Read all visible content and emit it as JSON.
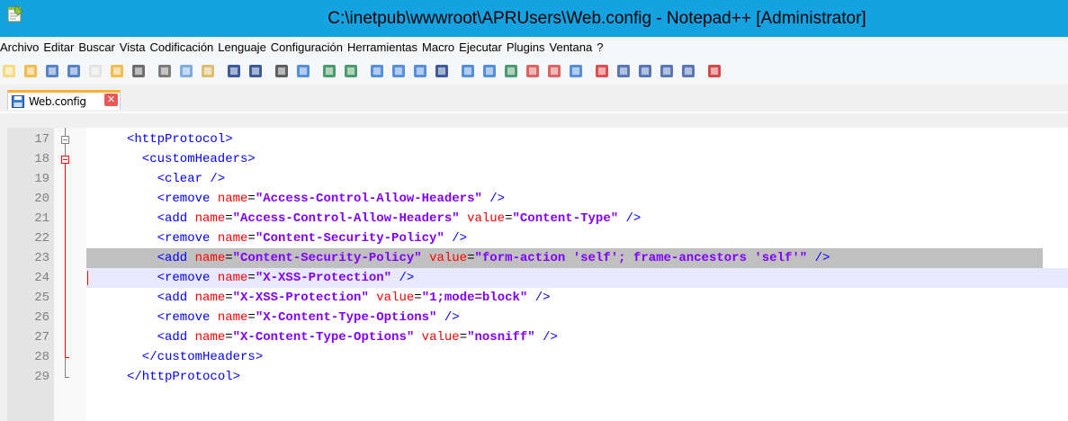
{
  "window": {
    "title": "C:\\inetpub\\wwwroot\\APRUsers\\Web.config - Notepad++ [Administrator]",
    "accent": "#15a2e1"
  },
  "menu": {
    "items": [
      "Archivo",
      "Editar",
      "Buscar",
      "Vista",
      "Codificación",
      "Lenguaje",
      "Configuración",
      "Herramientas",
      "Macro",
      "Ejecutar",
      "Plugins",
      "Ventana",
      "?"
    ]
  },
  "toolbar": {
    "icons": [
      "new-file-icon",
      "open-file-icon",
      "save-icon",
      "save-all-icon",
      "close-icon",
      "close-all-icon",
      "print-icon",
      "cut-icon",
      "copy-icon",
      "paste-icon",
      "undo-icon",
      "redo-icon",
      "find-icon",
      "replace-icon",
      "zoom-in-icon",
      "zoom-out-icon",
      "sync-vertical-icon",
      "sync-horizontal-icon",
      "word-wrap-icon",
      "show-all-chars-icon",
      "indent-guide-icon",
      "user-lang-icon",
      "doc-map-icon",
      "function-list-icon",
      "folder-workspace-icon",
      "monitor-icon",
      "record-macro-icon",
      "stop-macro-icon",
      "play-macro-icon",
      "run-macro-multiple-icon",
      "save-macro-icon",
      "spell-check-icon"
    ]
  },
  "tab": {
    "label": "Web.config",
    "close_symbol": "✕"
  },
  "editor": {
    "lines": [
      {
        "num": "17",
        "indent": "",
        "parts": [
          [
            "tag",
            "<httpProtocol>"
          ]
        ]
      },
      {
        "num": "18",
        "indent": "  ",
        "parts": [
          [
            "tag",
            "<customHeaders>"
          ]
        ]
      },
      {
        "num": "19",
        "indent": "    ",
        "parts": [
          [
            "tag",
            "<clear />"
          ]
        ]
      },
      {
        "num": "20",
        "indent": "    ",
        "parts": [
          [
            "tag",
            "<remove "
          ],
          [
            "attr",
            "name"
          ],
          [
            "eq",
            "="
          ],
          [
            "val",
            "\"Access-Control-Allow-Headers\""
          ],
          [
            "tag",
            " />"
          ]
        ]
      },
      {
        "num": "21",
        "indent": "    ",
        "parts": [
          [
            "tag",
            "<add "
          ],
          [
            "attr",
            "name"
          ],
          [
            "eq",
            "="
          ],
          [
            "val",
            "\"Access-Control-Allow-Headers\""
          ],
          [
            "tag",
            " "
          ],
          [
            "attr",
            "value"
          ],
          [
            "eq",
            "="
          ],
          [
            "val",
            "\"Content-Type\""
          ],
          [
            "tag",
            " />"
          ]
        ]
      },
      {
        "num": "22",
        "indent": "    ",
        "parts": [
          [
            "tag",
            "<remove "
          ],
          [
            "attr",
            "name"
          ],
          [
            "eq",
            "="
          ],
          [
            "val",
            "\"Content-Security-Policy\""
          ],
          [
            "tag",
            " />"
          ]
        ]
      },
      {
        "num": "23",
        "indent": "    ",
        "parts": [
          [
            "tag",
            "<add "
          ],
          [
            "attr",
            "name"
          ],
          [
            "eq",
            "="
          ],
          [
            "val",
            "\"Content-Security-Policy\""
          ],
          [
            "tag",
            " "
          ],
          [
            "attr",
            "value"
          ],
          [
            "eq",
            "="
          ],
          [
            "val",
            "\"form-action 'self'; frame-ancestors 'self'\""
          ],
          [
            "tag",
            " />"
          ]
        ]
      },
      {
        "num": "24",
        "indent": "    ",
        "parts": [
          [
            "tag",
            "<remove "
          ],
          [
            "attr",
            "name"
          ],
          [
            "eq",
            "="
          ],
          [
            "val",
            "\"X-XSS-Protection\""
          ],
          [
            "tag",
            " />"
          ]
        ]
      },
      {
        "num": "25",
        "indent": "    ",
        "parts": [
          [
            "tag",
            "<add "
          ],
          [
            "attr",
            "name"
          ],
          [
            "eq",
            "="
          ],
          [
            "val",
            "\"X-XSS-Protection\""
          ],
          [
            "tag",
            " "
          ],
          [
            "attr",
            "value"
          ],
          [
            "eq",
            "="
          ],
          [
            "val",
            "\"1;mode=block\""
          ],
          [
            "tag",
            " />"
          ]
        ]
      },
      {
        "num": "26",
        "indent": "    ",
        "parts": [
          [
            "tag",
            "<remove "
          ],
          [
            "attr",
            "name"
          ],
          [
            "eq",
            "="
          ],
          [
            "val",
            "\"X-Content-Type-Options\""
          ],
          [
            "tag",
            " />"
          ]
        ]
      },
      {
        "num": "27",
        "indent": "    ",
        "parts": [
          [
            "tag",
            "<add "
          ],
          [
            "attr",
            "name"
          ],
          [
            "eq",
            "="
          ],
          [
            "val",
            "\"X-Content-Type-Options\""
          ],
          [
            "tag",
            " "
          ],
          [
            "attr",
            "value"
          ],
          [
            "eq",
            "="
          ],
          [
            "val",
            "\"nosniff\""
          ],
          [
            "tag",
            " />"
          ]
        ]
      },
      {
        "num": "28",
        "indent": "  ",
        "parts": [
          [
            "tag",
            "</customHeaders>"
          ]
        ]
      },
      {
        "num": "29",
        "indent": "",
        "parts": [
          [
            "tag",
            "</httpProtocol>"
          ]
        ]
      }
    ],
    "selected_line": "23",
    "current_line": "24"
  }
}
